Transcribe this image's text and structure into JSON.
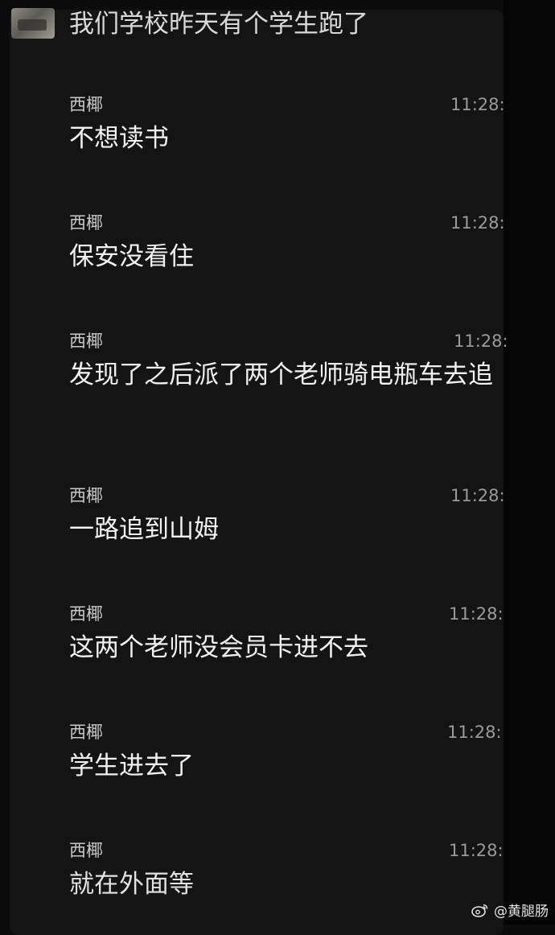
{
  "header": {
    "title": "我们学校昨天有个学生跑了"
  },
  "messages": [
    {
      "sender": "西椰",
      "time": "11:28:",
      "text": "不想读书"
    },
    {
      "sender": "西椰",
      "time": "11:28:",
      "text": "保安没看住"
    },
    {
      "sender": "西椰",
      "time": "11:28:",
      "text": "发现了之后派了两个老师骑电瓶车去追"
    },
    {
      "sender": "西椰",
      "time": "11:28:",
      "text": "一路追到山姆"
    },
    {
      "sender": "西椰",
      "time": "11:28:",
      "text": "这两个老师没会员卡进不去"
    },
    {
      "sender": "西椰",
      "time": "11:28:",
      "text": "学生进去了"
    },
    {
      "sender": "西椰",
      "time": "11:28:",
      "text": "就在外面等"
    }
  ],
  "watermark": {
    "icon": "weibo-icon",
    "text": "@黄腿肠"
  },
  "colors": {
    "background": "#0b0b0b",
    "panel": "#141414",
    "text": "#f1f1f1",
    "time": "#9a9a9a"
  }
}
